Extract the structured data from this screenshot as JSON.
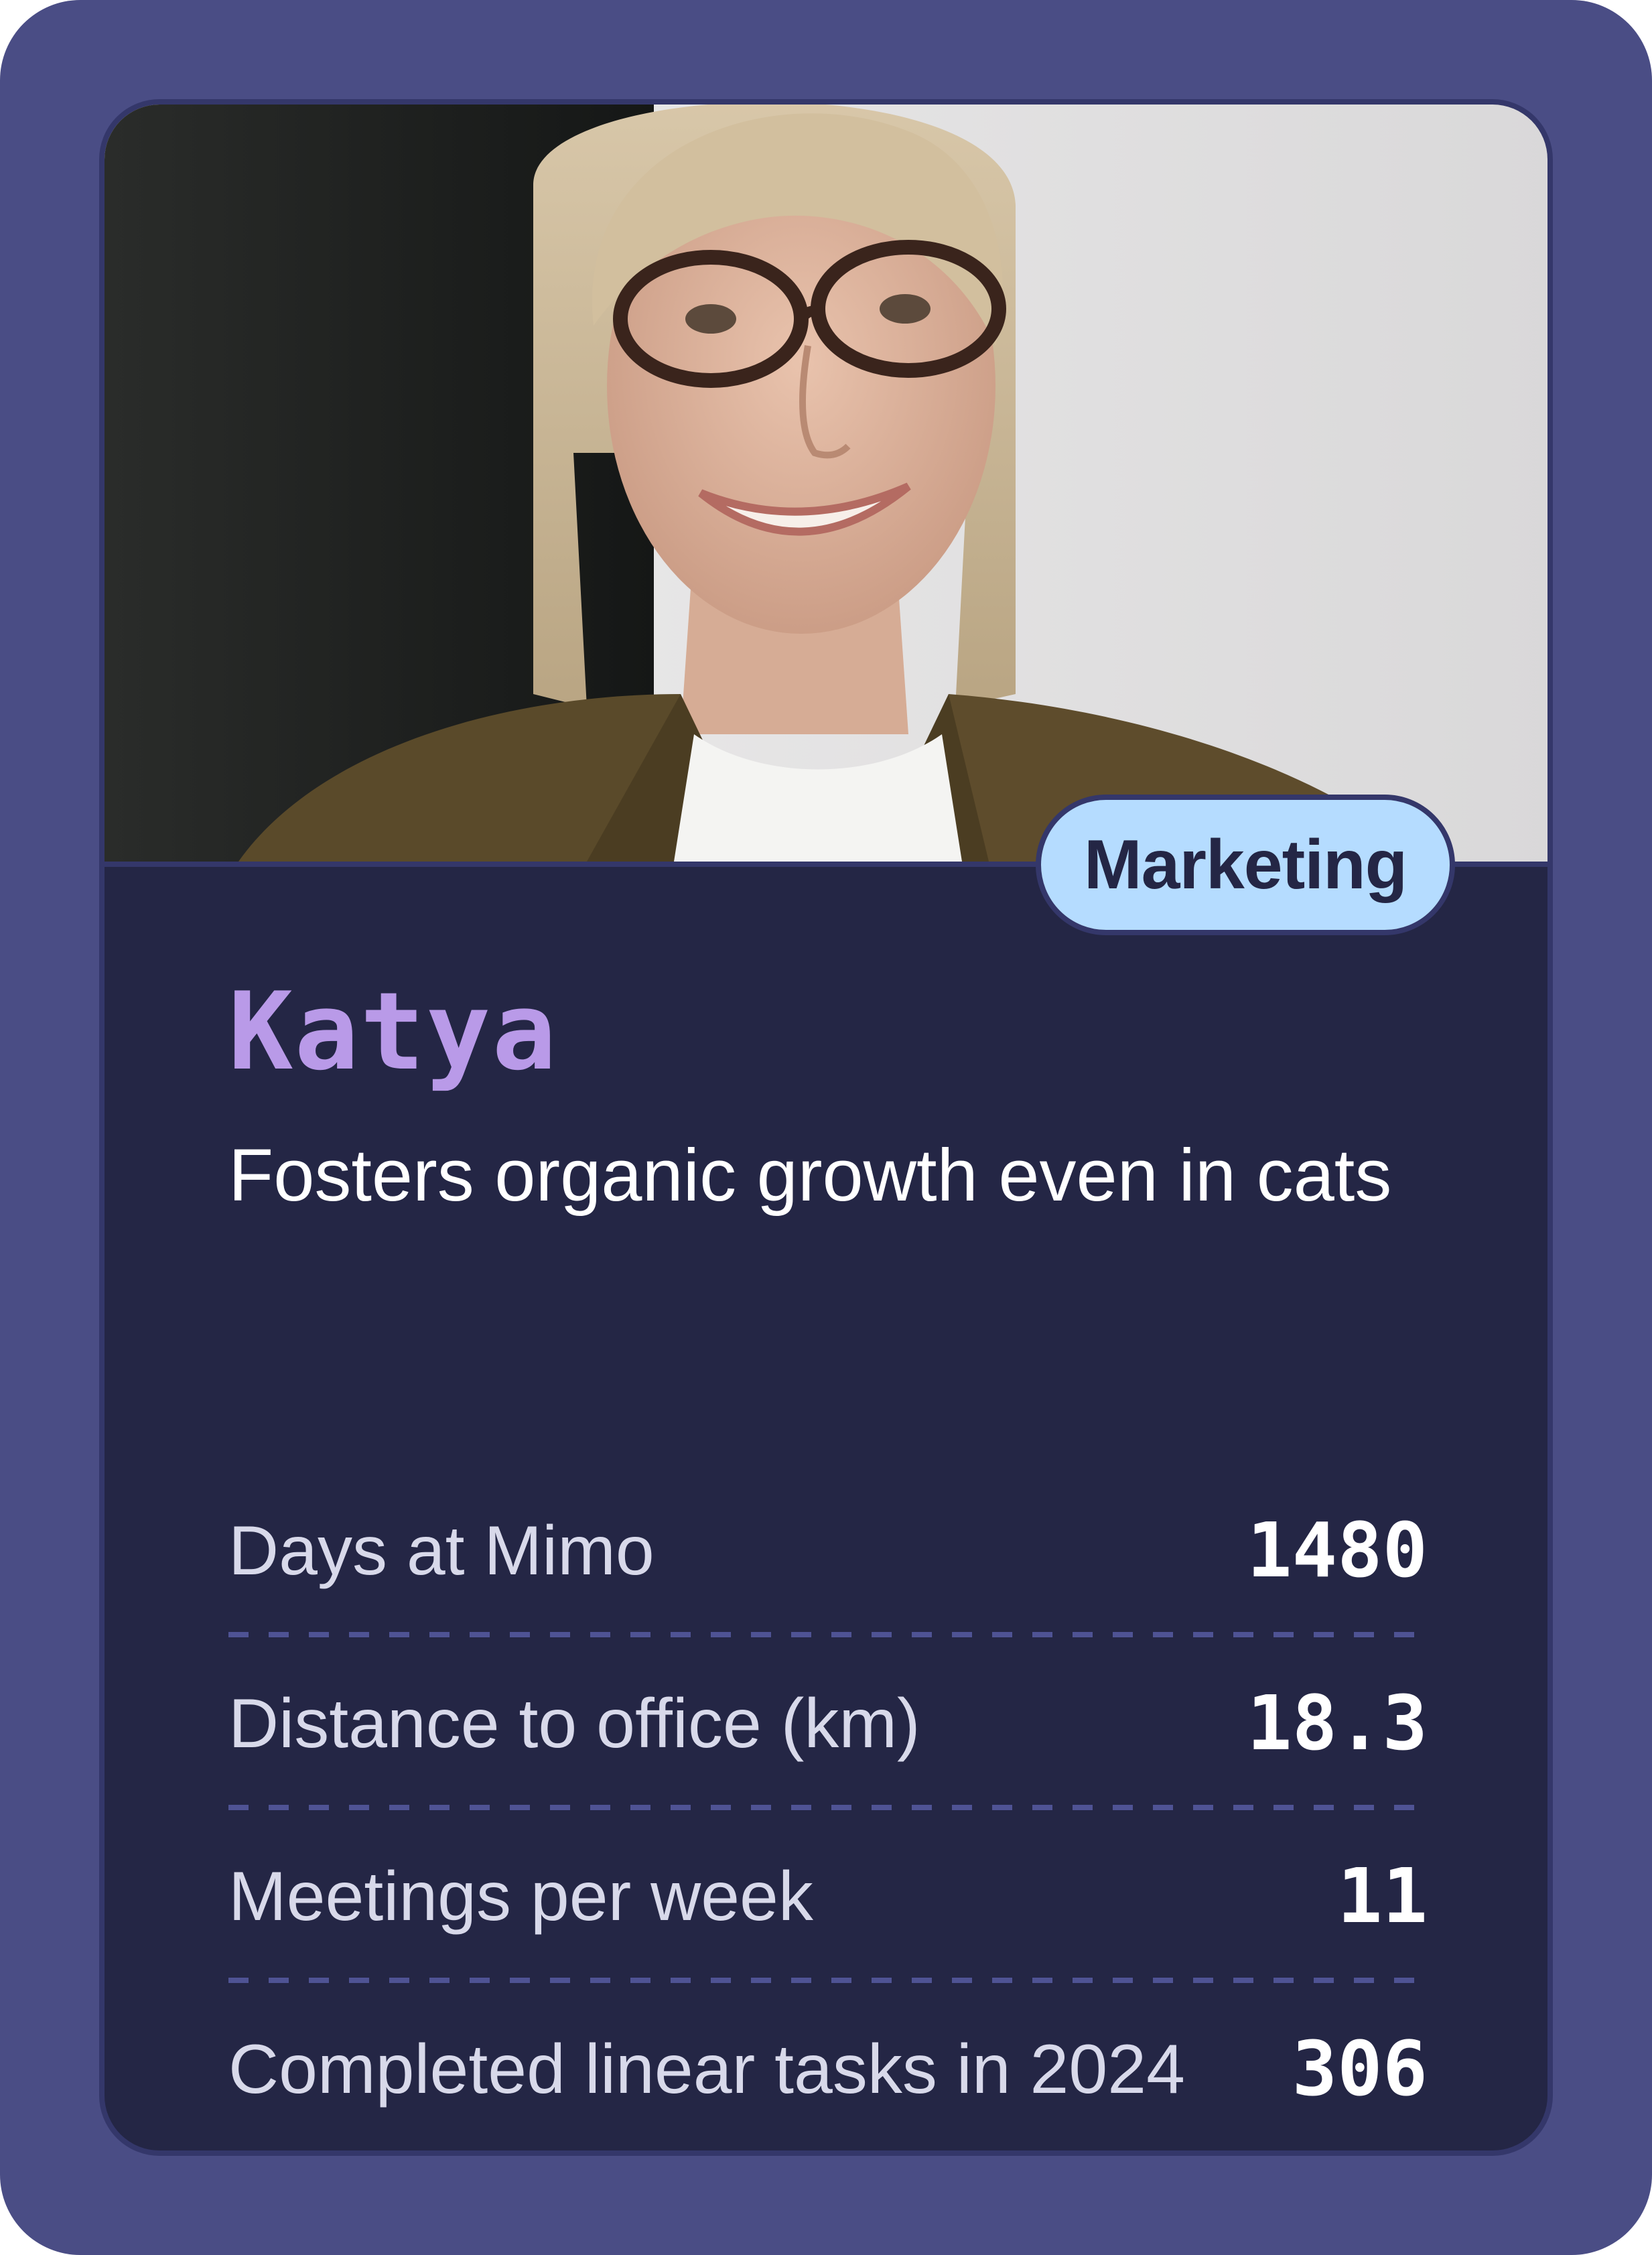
{
  "card": {
    "department": "Marketing",
    "name": "Katya",
    "tagline": "Fosters organic growth even in cats",
    "stats": [
      {
        "label": "Days at Mimo",
        "value": "1480"
      },
      {
        "label": "Distance to office (km)",
        "value": "18.3"
      },
      {
        "label": "Meetings per week",
        "value": "11"
      },
      {
        "label": "Completed linear tasks in 2024",
        "value": "306"
      }
    ]
  },
  "colors": {
    "frame": "#4a4d85",
    "panel": "#242645",
    "name": "#b99ae8",
    "badge": "#b5dcff"
  }
}
